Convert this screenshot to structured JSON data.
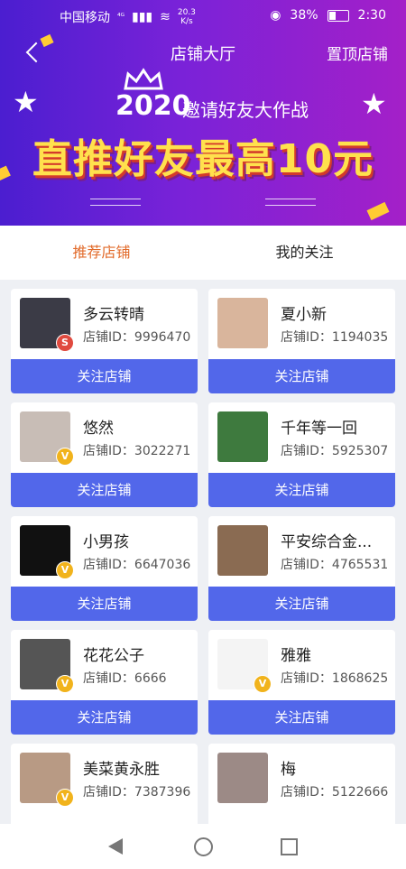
{
  "status_bar": {
    "carrier": "中国移动",
    "network": "⁴ᴳ",
    "speed_top": "20.3",
    "speed_bottom": "K/s",
    "battery": "38%",
    "time": "2:30"
  },
  "navbar": {
    "title": "店铺大厅",
    "pin_label": "置顶店铺"
  },
  "banner": {
    "year": "2020",
    "subtitle": "邀请好友大作战",
    "slogan": "直推好友最高10元"
  },
  "tabs": [
    {
      "label": "推荐店铺",
      "active": true
    },
    {
      "label": "我的关注",
      "active": false
    }
  ],
  "shops": [
    {
      "name": "多云转晴",
      "id_text": "店铺ID：9996470",
      "badge": "S",
      "badge_color": "#e04a3f",
      "avatar_color": "#3b3b46",
      "button": "关注店铺"
    },
    {
      "name": "夏小新",
      "id_text": "店铺ID：1194035",
      "badge": "",
      "badge_color": "",
      "avatar_color": "#d9b59c",
      "button": "关注店铺"
    },
    {
      "name": "悠然",
      "id_text": "店铺ID：3022271",
      "badge": "V",
      "badge_color": "#f1b31c",
      "avatar_color": "#c8bdb6",
      "button": "关注店铺"
    },
    {
      "name": "千年等一回",
      "id_text": "店铺ID：5925307",
      "badge": "",
      "badge_color": "",
      "avatar_color": "#3e7a3e",
      "button": "关注店铺"
    },
    {
      "name": "小男孩",
      "id_text": "店铺ID：6647036",
      "badge": "V",
      "badge_color": "#f1b31c",
      "avatar_color": "#111111",
      "button": "关注店铺"
    },
    {
      "name": "平安综合金...",
      "id_text": "店铺ID：4765531",
      "badge": "",
      "badge_color": "",
      "avatar_color": "#8a6b52",
      "button": "关注店铺"
    },
    {
      "name": "花花公子",
      "id_text": "店铺ID：6666",
      "badge": "V",
      "badge_color": "#f1b31c",
      "avatar_color": "#555555",
      "button": "关注店铺"
    },
    {
      "name": "雅雅",
      "id_text": "店铺ID：1868625",
      "badge": "V",
      "badge_color": "#f1b31c",
      "avatar_color": "#f4f4f4",
      "button": "关注店铺"
    },
    {
      "name": "美菜黄永胜",
      "id_text": "店铺ID：7387396",
      "badge": "V",
      "badge_color": "#f1b31c",
      "avatar_color": "#b89a84",
      "button": ""
    },
    {
      "name": "梅",
      "id_text": "店铺ID：5122666",
      "badge": "",
      "badge_color": "",
      "avatar_color": "#9c8a86",
      "button": ""
    }
  ],
  "colors": {
    "accent_tab": "#e26b2b",
    "follow_button": "#5267ea"
  }
}
